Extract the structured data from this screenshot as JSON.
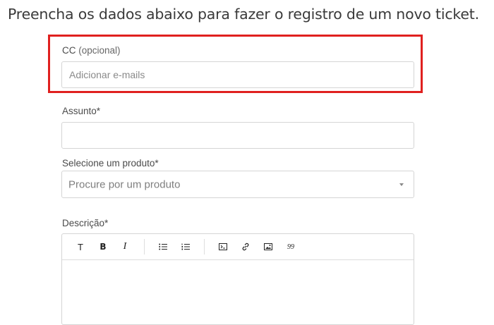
{
  "header": {
    "title": "Preencha os dados abaixo para fazer o registro de um novo ticket."
  },
  "cc": {
    "label": "CC",
    "optional_label": "(opcional)",
    "placeholder": "Adicionar e-mails",
    "value": ""
  },
  "subject": {
    "label": "Assunto*",
    "value": ""
  },
  "product": {
    "label": "Selecione um produto*",
    "placeholder": "Procure por um produto"
  },
  "description": {
    "label": "Descrição*",
    "toolbar": {
      "text_glyph": "T",
      "bold_glyph": "B",
      "italic_glyph": "I",
      "quote_glyph": "99"
    },
    "icons": [
      "text-style-icon",
      "bold-icon",
      "italic-icon",
      "bullet-list-icon",
      "numbered-list-icon",
      "code-block-icon",
      "link-icon",
      "image-icon",
      "quote-icon"
    ]
  },
  "colors": {
    "highlight": "#e0201f",
    "border": "#d5d5d5",
    "placeholder": "#8a8a8a"
  }
}
